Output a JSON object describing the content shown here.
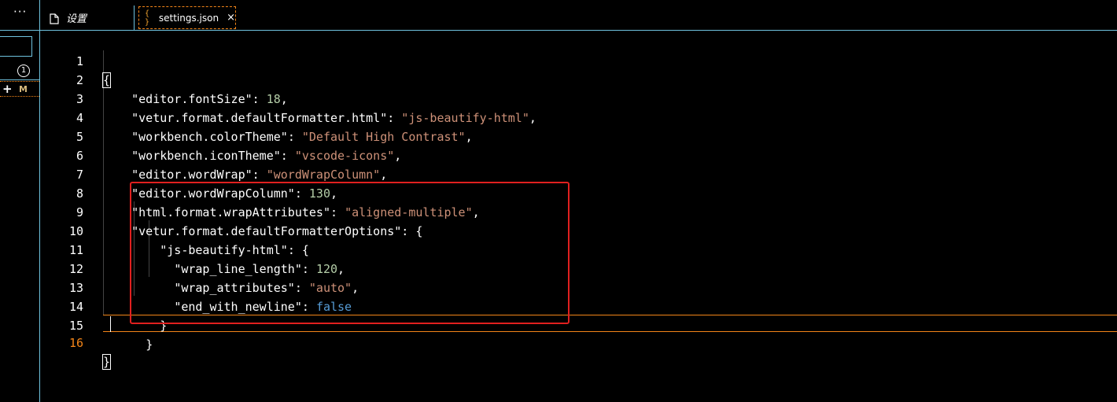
{
  "sidebar": {
    "more_label": "···",
    "badge_count": "1",
    "plus_label": "+",
    "modified_flag": "M"
  },
  "tabs": [
    {
      "label": "设置",
      "icon": "file-icon"
    },
    {
      "label": "settings.json",
      "icon": "json-braces-icon",
      "close": "×",
      "icon_glyph": "{ }"
    }
  ],
  "editor": {
    "active_line": 16,
    "lines": [
      {
        "number": "1"
      },
      {
        "number": "2",
        "key": "\"editor.fontSize\"",
        "value": "18"
      },
      {
        "number": "3",
        "key": "\"vetur.format.defaultFormatter.html\"",
        "value": "\"js-beautify-html\""
      },
      {
        "number": "4",
        "key": "\"workbench.colorTheme\"",
        "value": "\"Default High Contrast\""
      },
      {
        "number": "5",
        "key": "\"workbench.iconTheme\"",
        "value": "\"vscode-icons\""
      },
      {
        "number": "6",
        "key": "\"editor.wordWrap\"",
        "value": "\"wordWrapColumn\""
      },
      {
        "number": "7",
        "key": "\"editor.wordWrapColumn\"",
        "value": "130"
      },
      {
        "number": "8",
        "key": "\"html.format.wrapAttributes\"",
        "value": "\"aligned-multiple\""
      },
      {
        "number": "9",
        "key": "\"vetur.format.defaultFormatterOptions\""
      },
      {
        "number": "10",
        "key": "\"js-beautify-html\""
      },
      {
        "number": "11",
        "key": "\"wrap_line_length\"",
        "value": "120"
      },
      {
        "number": "12",
        "key": "\"wrap_attributes\"",
        "value": "\"auto\""
      },
      {
        "number": "13",
        "key": "\"end_with_newline\"",
        "value": "false"
      },
      {
        "number": "14"
      },
      {
        "number": "15"
      },
      {
        "number": "16"
      }
    ]
  },
  "colors": {
    "border": "#6fc3df",
    "accent": "#f38518",
    "string": "#ce9178",
    "number": "#b5cea8",
    "boolean": "#569cd6",
    "highlight": "#e0201f"
  }
}
